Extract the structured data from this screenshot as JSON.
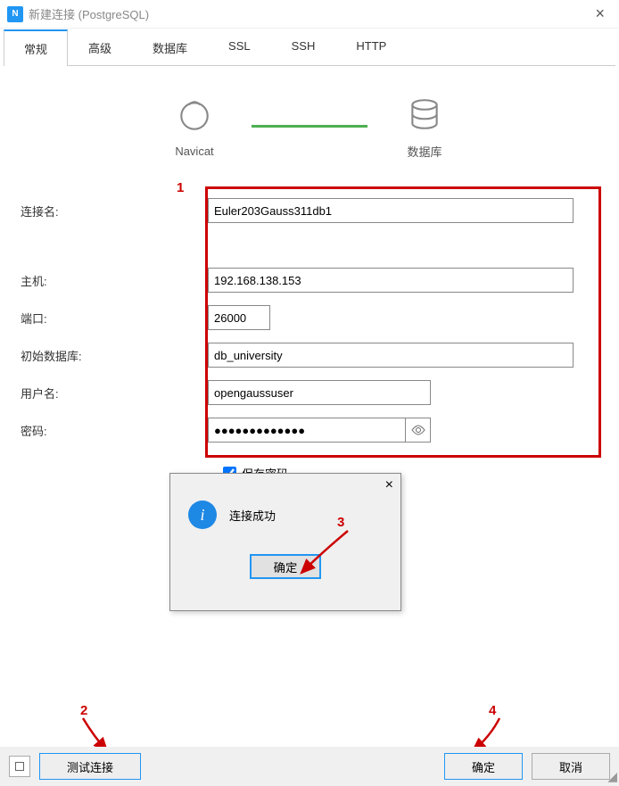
{
  "titlebar": {
    "title": "新建连接 (PostgreSQL)"
  },
  "tabs": [
    "常规",
    "高级",
    "数据库",
    "SSL",
    "SSH",
    "HTTP"
  ],
  "diagram": {
    "left_label": "Navicat",
    "right_label": "数据库"
  },
  "form": {
    "conn_name_label": "连接名:",
    "conn_name_value": "Euler203Gauss311db1",
    "host_label": "主机:",
    "host_value": "192.168.138.153",
    "port_label": "端口:",
    "port_value": "26000",
    "initdb_label": "初始数据库:",
    "initdb_value": "db_university",
    "user_label": "用户名:",
    "user_value": "opengaussuser",
    "pwd_label": "密码:",
    "pwd_value": "●●●●●●●●●●●●●",
    "savepw_label": "保存密码"
  },
  "popup": {
    "message": "连接成功",
    "ok_label": "确定"
  },
  "buttons": {
    "test": "测试连接",
    "ok": "确定",
    "cancel": "取消"
  },
  "annotations": {
    "a1": "1",
    "a2": "2",
    "a3": "3",
    "a4": "4"
  }
}
